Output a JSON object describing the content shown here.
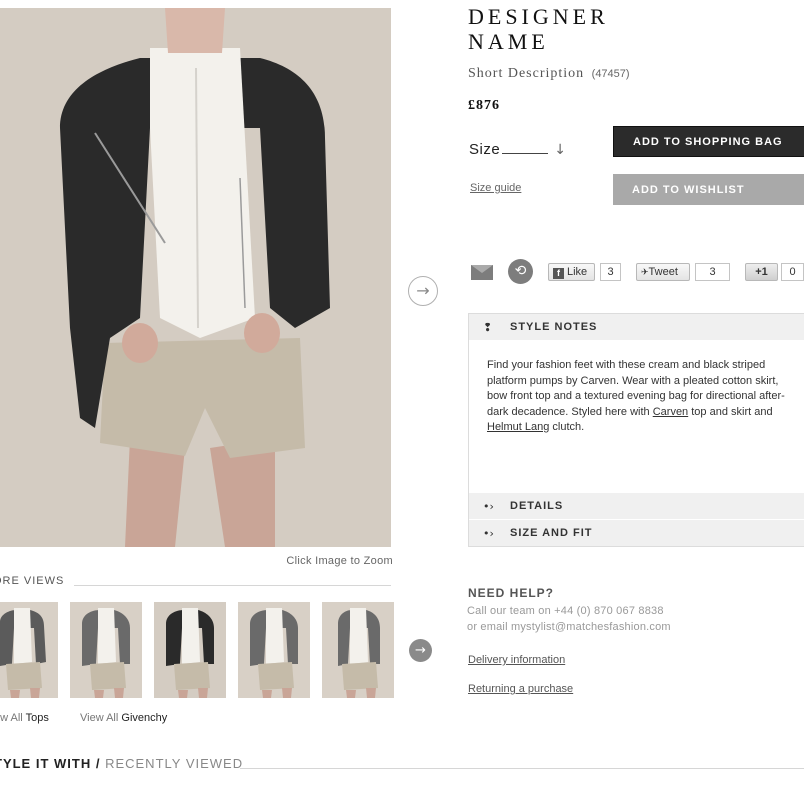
{
  "product": {
    "designer": "DESIGNER NAME",
    "short_description": "Short Description",
    "code": "(47457)",
    "price": "£876",
    "size_label": "Size",
    "size_guide": "Size guide",
    "add_to_bag": "ADD TO SHOPPING BAG",
    "add_to_wishlist": "ADD TO WISHLIST"
  },
  "gallery": {
    "zoom_hint": "Click Image to Zoom",
    "more_views_label": "ORE VIEWS",
    "thumbnail_count": 5,
    "selected_thumbnail": 2
  },
  "view_all": [
    {
      "prefix": "ew All",
      "name": "Tops"
    },
    {
      "prefix": "View All",
      "name": "Givenchy"
    }
  ],
  "style_with": {
    "active": "TYLE IT WITH /",
    "inactive": "RECENTLY VIEWED"
  },
  "share": {
    "email_icon": "mail-icon",
    "share_icon": "sync-icon",
    "like_label": "Like",
    "like_count": "3",
    "tweet_label": "Tweet",
    "tweet_count": "3",
    "plusone_label": "+1",
    "plusone_count": "0"
  },
  "accordion": {
    "style_notes_title": "STYLE NOTES",
    "notes_part1": "Find your fashion feet with these cream and black striped platform pumps by Carven. Wear with a pleated cotton skirt, bow front top and a textured evening bag for directional after-dark decadence. Styled here with ",
    "notes_link1": "Carven",
    "notes_part2": " top and skirt and ",
    "notes_link2": "Helmut Lang",
    "notes_part3": " clutch.",
    "details_title": "DETAILS",
    "size_fit_title": "SIZE AND FIT"
  },
  "help": {
    "title": "NEED HELP?",
    "line1": "Call our team on +44 (0) 870 067 8838",
    "line2": "or email mystylist@matchesfashion.com",
    "delivery": "Delivery information",
    "returning": "Returning a purchase"
  },
  "colors": {
    "primary_button": "#2b2b2b",
    "secondary_button": "#a9a9a9",
    "accordion_header": "#f0f0f0"
  }
}
